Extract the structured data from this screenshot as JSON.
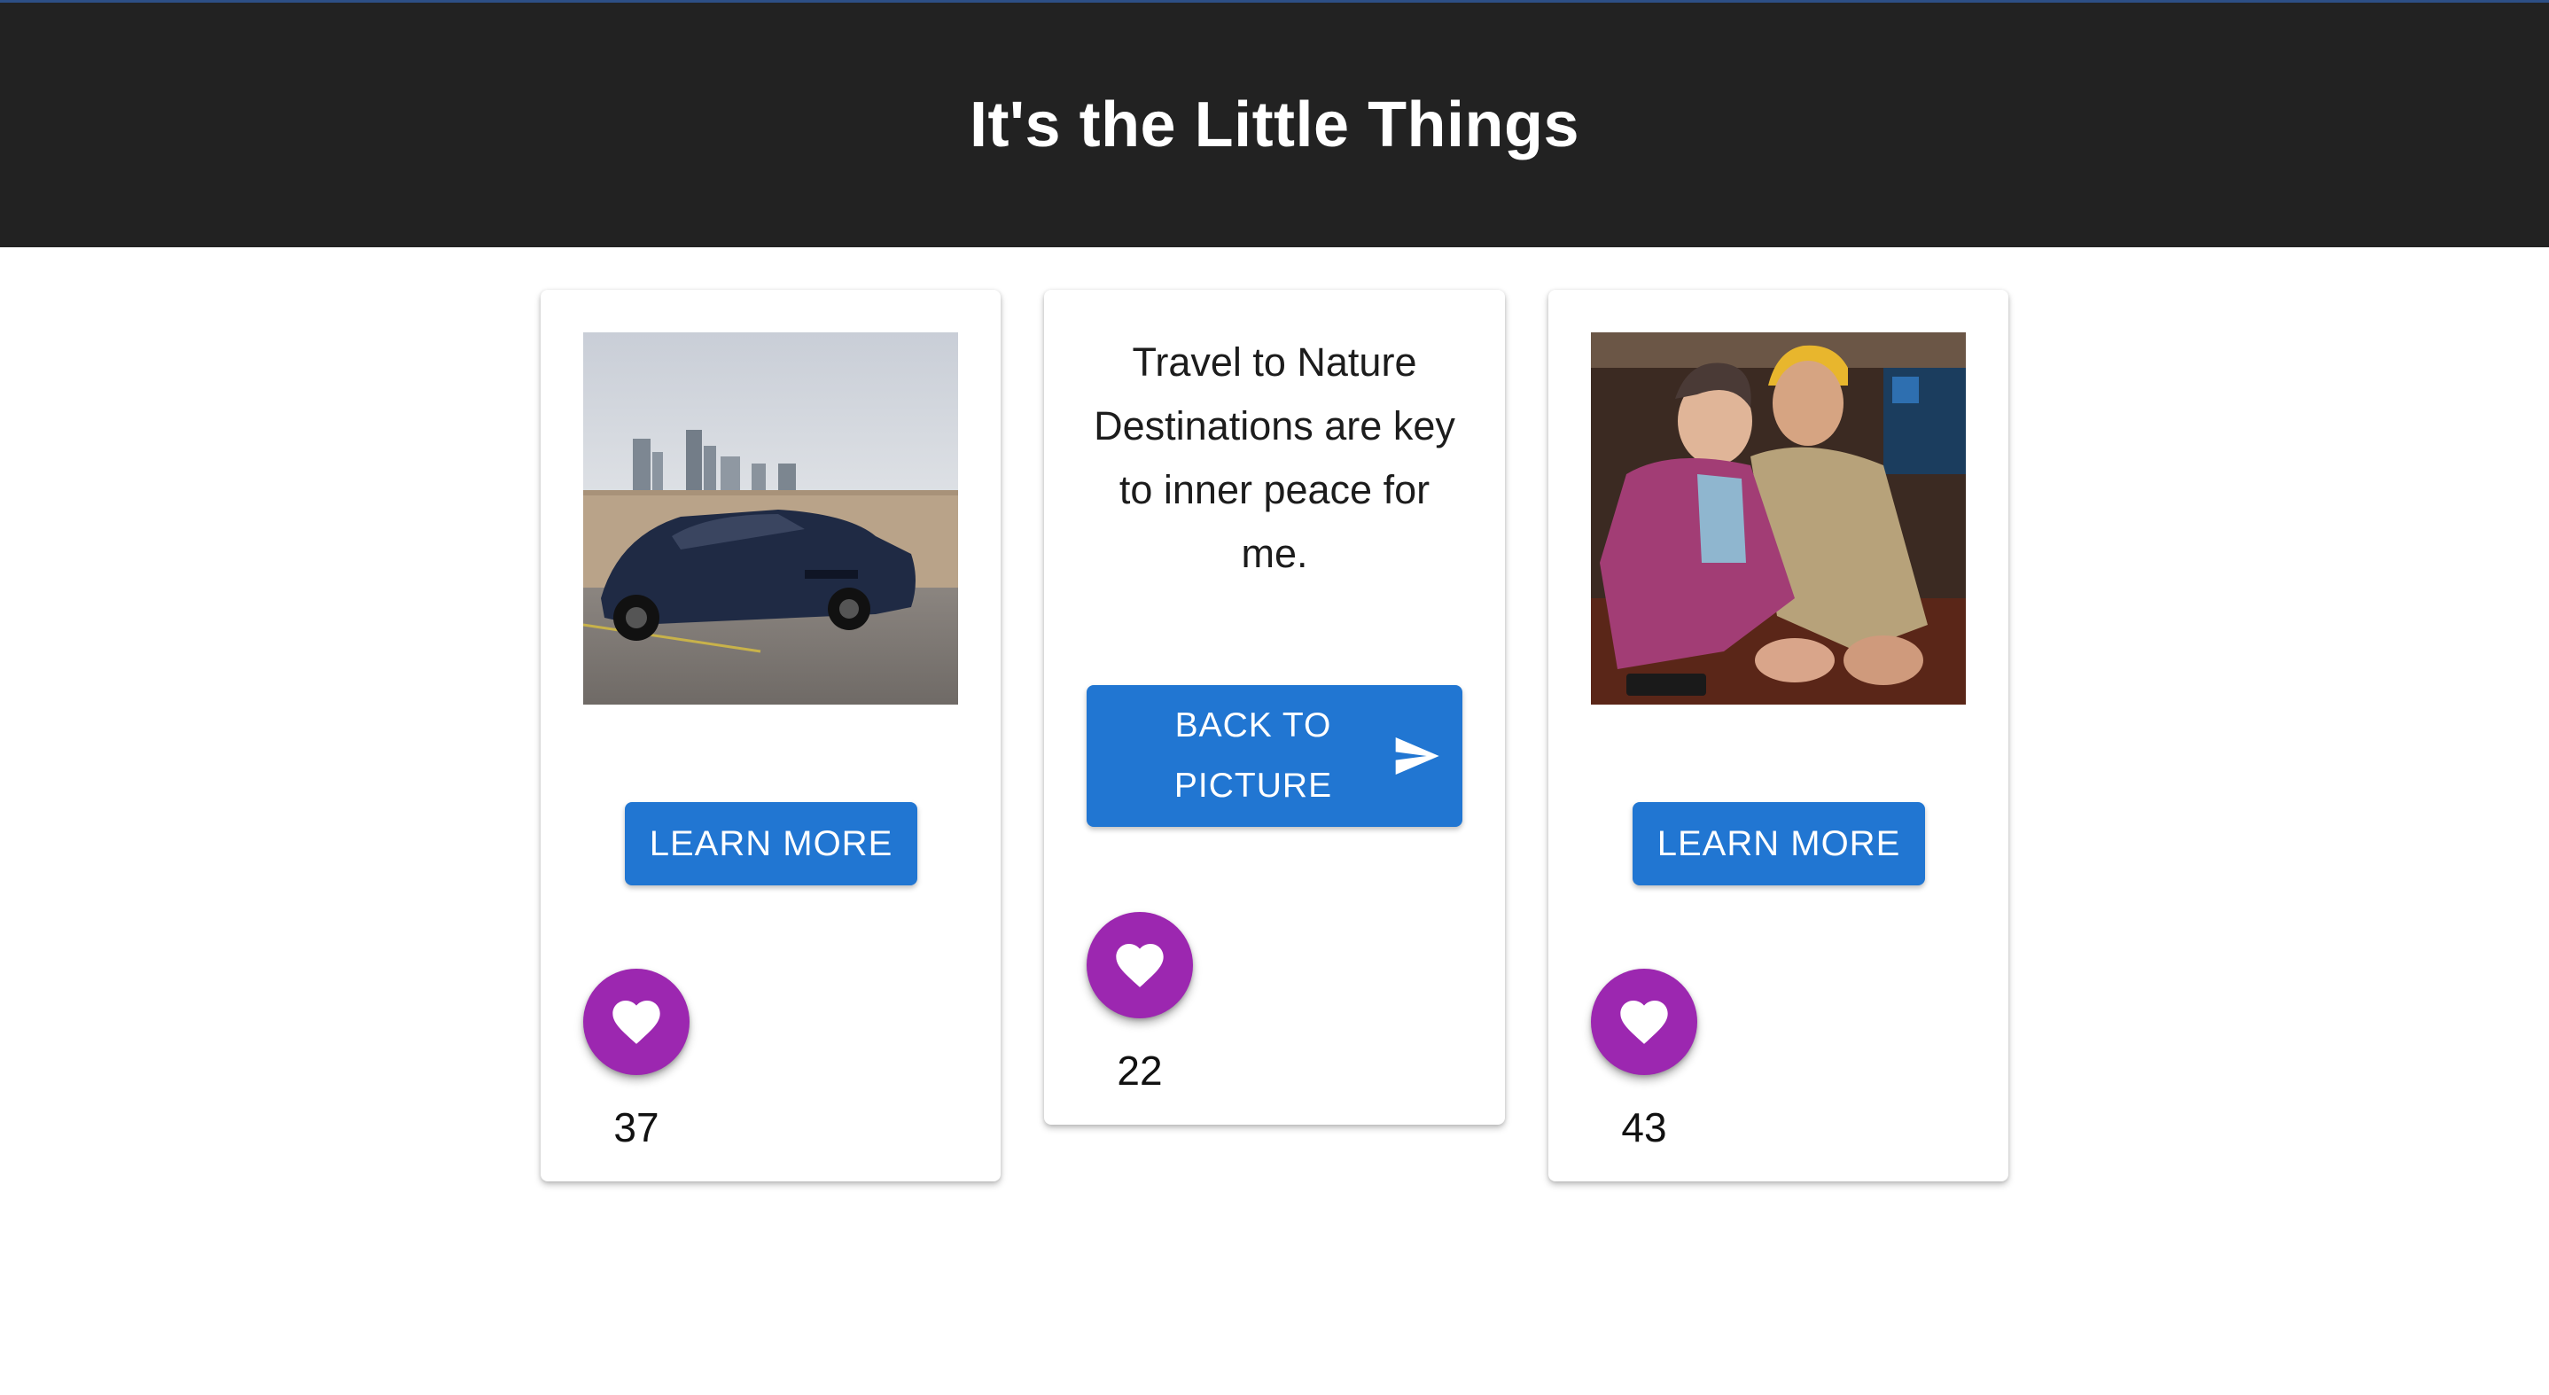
{
  "header": {
    "title": "It's the Little Things"
  },
  "cards": [
    {
      "type": "photo",
      "image_alt": "dark blue Corvette parked on a rooftop with a city skyline behind",
      "button_label": "LEARN MORE",
      "like_icon": "heart-icon",
      "like_count": "37"
    },
    {
      "type": "text",
      "quote": "Travel to Nature Destinations are key to inner peace for me.",
      "button_label": "BACK TO PICTURE",
      "button_icon": "send-icon",
      "like_icon": "heart-icon",
      "like_count": "22"
    },
    {
      "type": "photo",
      "image_alt": "elderly woman and young man in a yellow cap posing together at a table",
      "button_label": "LEARN MORE",
      "like_icon": "heart-icon",
      "like_count": "43"
    }
  ],
  "colors": {
    "header_bg": "#222222",
    "header_text": "#ffffff",
    "primary_button": "#2176d2",
    "like_button": "#9c27b0",
    "page_bg": "#ffffff"
  }
}
